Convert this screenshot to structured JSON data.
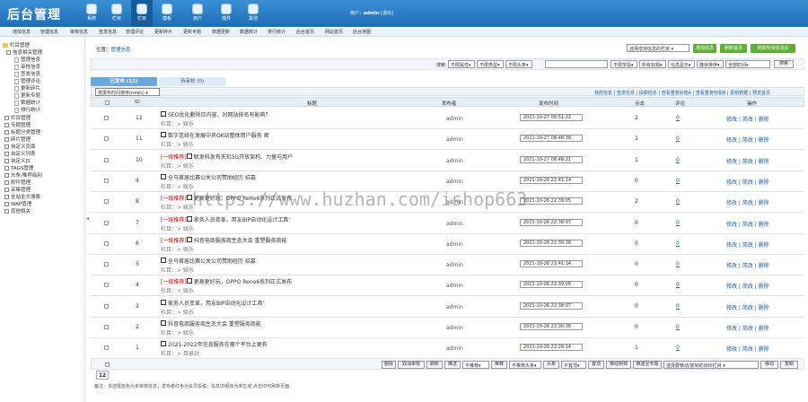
{
  "header": {
    "logo": "后台管理",
    "nav": [
      "系统",
      "栏目",
      "栏目",
      "模板",
      "用户",
      "插件",
      "其他"
    ],
    "user_prefix": "用户：",
    "user_name": "admin",
    "logout": "[退出]"
  },
  "subnav": [
    "增加信息",
    "管理信息",
    "审核信息",
    "签发信息",
    "管理评论",
    "更新碎片",
    "更新专题",
    "数据更新",
    "数据统计",
    "排行统计",
    "后台首页",
    "网站首页",
    "后台地图"
  ],
  "sidebar": [
    "栏目管理",
    "信息相关管理",
    "管理信息",
    "审核信息",
    "签发信息",
    "管理评论",
    "更新碎片",
    "更新专题",
    "数据统计",
    "排行统计",
    "栏目管理",
    "专题管理",
    "标题分类管理",
    "碎片管理",
    "自定义页面",
    "自定义列表",
    "自定义JS",
    "TAGS管理",
    "头条/推荐级别",
    "附件管理",
    "采集管理",
    "全站全文搜索",
    "WAP管理",
    "其他相关"
  ],
  "breadcrumb": {
    "prefix": "位置：",
    "link": "管理信息"
  },
  "toolbar": {
    "column_select": "选择增加信息的栏目",
    "buttons": [
      "增加信息",
      "刷新首页",
      "刷新所有信息JS"
    ]
  },
  "filter": {
    "label": "搜索：",
    "selects": [
      "不限属性",
      "不限类型",
      "不限头条"
    ],
    "selects2": [
      "不限字段",
      "所有标题",
      "信息显示",
      "降序排序",
      "全部时间"
    ],
    "search_btn": "搜索"
  },
  "tabs": [
    "已发布 (12)",
    "待审核 (0)"
  ],
  "table_bar": {
    "order_select": "按发布时间排序(news)",
    "links": "我的信息 | 签发信息 | 投稿信息 | 查看重复标题A | 查看重复标题B | 更新数据 | 预览首页"
  },
  "columns": [
    "ID",
    "标题",
    "发布者",
    "发布时间",
    "点击",
    "评论",
    "操作"
  ],
  "rows": [
    {
      "id": "12",
      "tag": "",
      "title": "SEO优化删除日内容，对网站排名有影响？",
      "cat": "栏目：> 娱乐",
      "author": "admin",
      "time": "2021-10-27 08:51:22",
      "clicks": "2",
      "comments": "0"
    },
    {
      "id": "11",
      "tag": "",
      "title": "数字连续在发展中央OK站整体用户服务 顺",
      "cat": "栏目：> 娱乐",
      "author": "admin",
      "time": "2021-10-27 08:48:38",
      "clicks": "1",
      "comments": "0"
    },
    {
      "id": "10",
      "tag": "[一级推荐]",
      "title": "联发科发布天玑5G开放架构、力量与用户",
      "cat": "栏目：> 娱乐",
      "author": "admin",
      "time": "2021-10-27 08:48:21",
      "clicks": "1",
      "comments": "0"
    },
    {
      "id": "9",
      "tag": "",
      "title": "全马首届比赛公关公司赞助经历 招募",
      "cat": "栏目：> 娱乐",
      "author": "admin",
      "time": "2021-10-26 22:41:14",
      "clicks": "0",
      "comments": "0"
    },
    {
      "id": "8",
      "tag": "[一级推荐]",
      "title": "更高更好玩，OPPO Reno6系列正式发布",
      "cat": "栏目：> 娱乐",
      "author": "admin",
      "time": "2021-10-26 22:39:05",
      "clicks": "2",
      "comments": "0"
    },
    {
      "id": "7",
      "tag": "[一级推荐]",
      "title": "家务人员变革，用友BIP自动化设计工具'",
      "cat": "栏目：> 娱乐",
      "author": "admin",
      "time": "2021-10-26 22:38:07",
      "clicks": "0",
      "comments": "0"
    },
    {
      "id": "6",
      "tag": "[一级推荐]",
      "title": "抖音电商服务商生态大会 重塑服务商能",
      "cat": "栏目：> 娱乐",
      "author": "admin",
      "time": "2021-10-26 22:30:38",
      "clicks": "0",
      "comments": "0"
    },
    {
      "id": "5",
      "tag": "",
      "title": "全马首届比赛公关公司赞助经历 招募",
      "cat": "栏目：> 娱乐",
      "author": "admin",
      "time": "2021-10-26 22:41:14",
      "clicks": "0",
      "comments": "0"
    },
    {
      "id": "4",
      "tag": "[一级推荐]",
      "title": "更高更好玩，OPPO Reno6系列正式发布",
      "cat": "栏目：> 娱乐",
      "author": "admin",
      "time": "2021-10-26 22:39:05",
      "clicks": "0",
      "comments": "0"
    },
    {
      "id": "3",
      "tag": "",
      "title": "家务人员变革，用友BIP自动化设计工具'",
      "cat": "栏目：> 娱乐",
      "author": "admin",
      "time": "2021-10-26 22:38:07",
      "clicks": "0",
      "comments": "0"
    },
    {
      "id": "2",
      "tag": "",
      "title": "抖音电商服务商生态大会 重塑服务商能",
      "cat": "栏目：> 娱乐",
      "author": "admin",
      "time": "2021-10-26 22:30:38",
      "clicks": "0",
      "comments": "0"
    },
    {
      "id": "1",
      "tag": "",
      "title": "2021-2022年信息服务在哪个平台上更有",
      "cat": "栏目：> 目录站",
      "author": "admin",
      "time": "2021-10-26 22:28:14",
      "clicks": "1",
      "comments": "0"
    }
  ],
  "row_actions": "修改 | 简改 | 删除",
  "bottom": {
    "buttons": [
      "删除",
      "取消审核",
      "刷新",
      "推送",
      "推荐",
      "头条",
      "置顶",
      "归档",
      "移动",
      "复制"
    ],
    "selects": [
      "不推荐",
      "不推荐头条",
      "不置顶"
    ],
    "mid_buttons": [
      "置顶",
      "移动到档",
      "推送至专题"
    ],
    "move_select": "选择要移动/复制的目标栏目"
  },
  "page_count": "12",
  "note": "备注：多选框蓝色为未审核信息；发布者红色为会员投稿；信息ID粗体为未生成,点击ID可刷新页面.",
  "watermark": "https://www.huzhan.com/ishop663"
}
